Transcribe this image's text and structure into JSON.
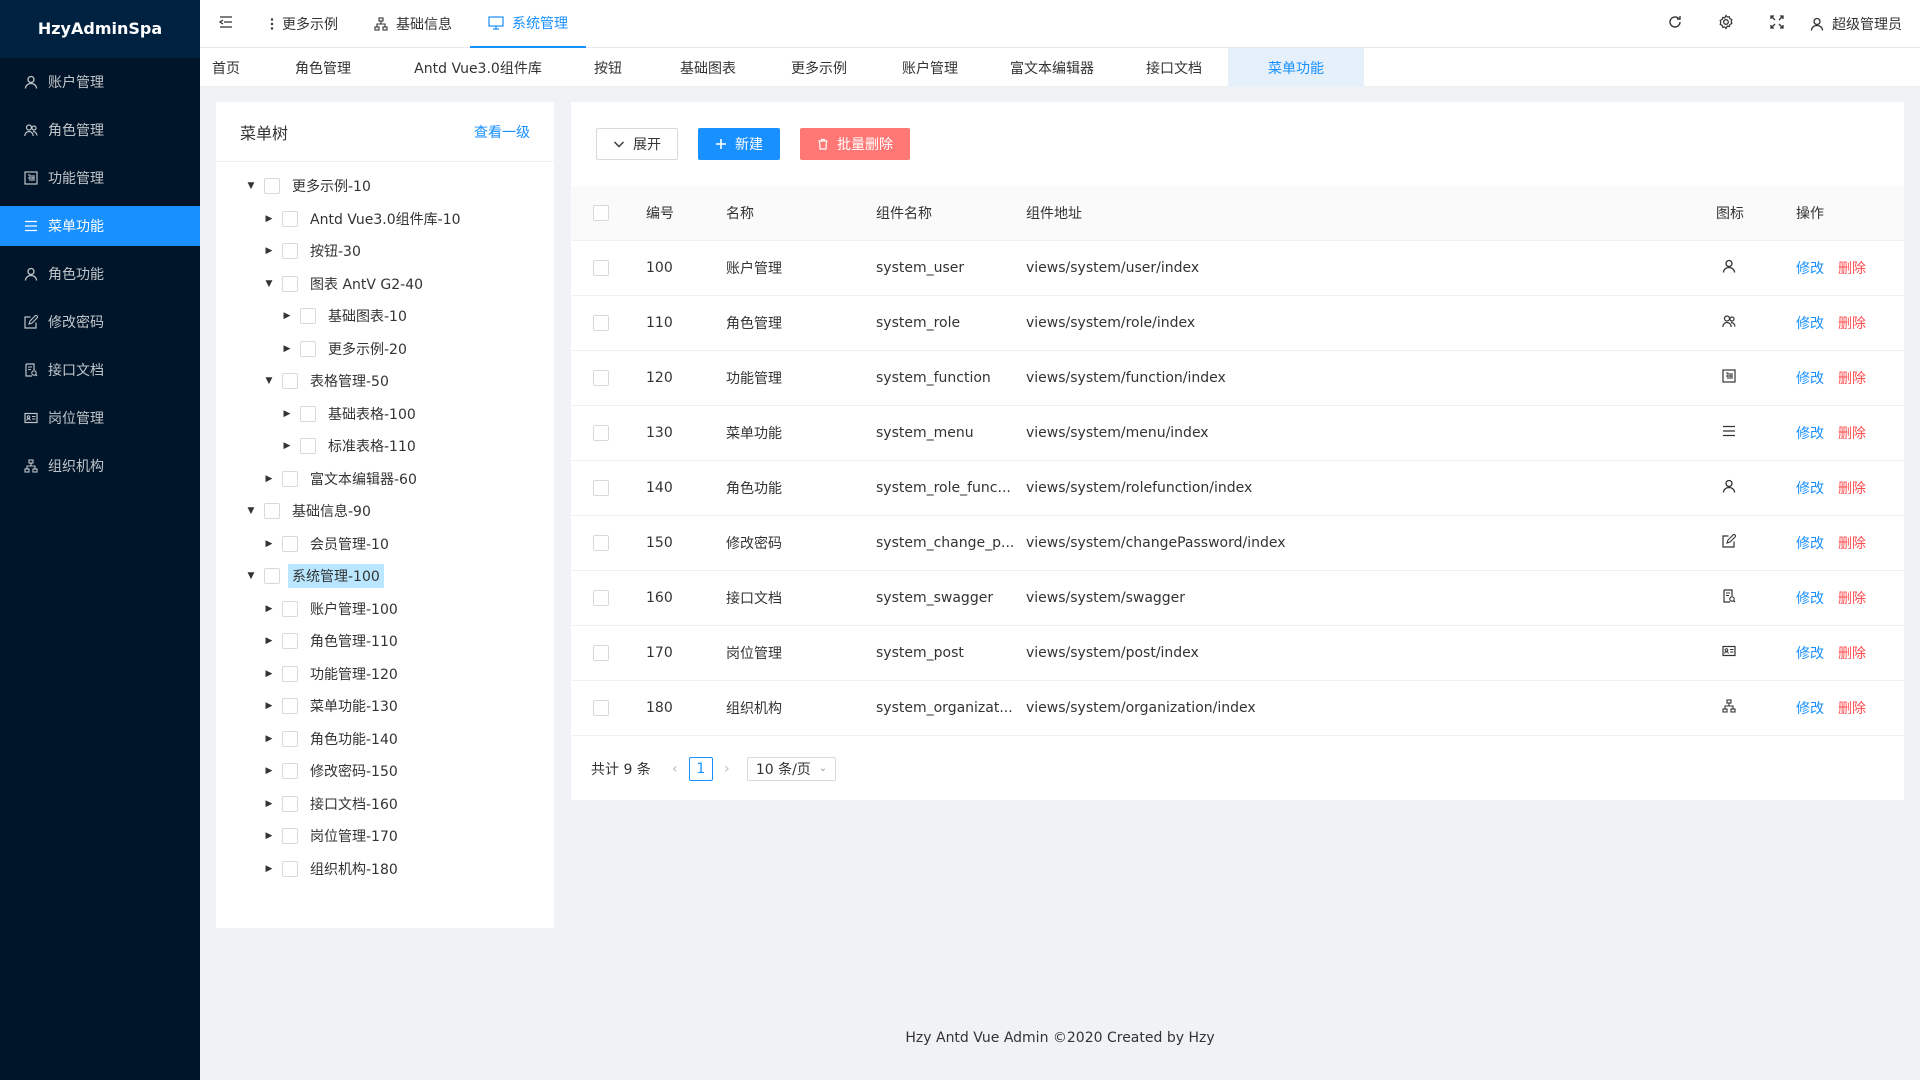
{
  "app": {
    "title": "HzyAdminSpa"
  },
  "sidebar": {
    "items": [
      {
        "label": "账户管理",
        "icon": "user-icon",
        "active": false
      },
      {
        "label": "角色管理",
        "icon": "team-icon",
        "active": false
      },
      {
        "label": "功能管理",
        "icon": "function-icon",
        "active": false
      },
      {
        "label": "菜单功能",
        "icon": "menu-icon",
        "active": true
      },
      {
        "label": "角色功能",
        "icon": "user-icon",
        "active": false
      },
      {
        "label": "修改密码",
        "icon": "edit-icon",
        "active": false
      },
      {
        "label": "接口文档",
        "icon": "doc-icon",
        "active": false
      },
      {
        "label": "岗位管理",
        "icon": "idcard-icon",
        "active": false
      },
      {
        "label": "组织机构",
        "icon": "cluster-icon",
        "active": false
      }
    ]
  },
  "header": {
    "menu": [
      {
        "label": "更多示例",
        "icon": "more-vertical-icon",
        "active": false
      },
      {
        "label": "基础信息",
        "icon": "cluster-icon",
        "active": false
      },
      {
        "label": "系统管理",
        "icon": "desktop-icon",
        "active": true
      }
    ],
    "user": "超级管理员"
  },
  "tabs": [
    {
      "label": "首页",
      "active": false
    },
    {
      "label": "角色管理",
      "active": false
    },
    {
      "label": "Antd Vue3.0组件库",
      "active": false
    },
    {
      "label": "按钮",
      "active": false
    },
    {
      "label": "基础图表",
      "active": false
    },
    {
      "label": "更多示例",
      "active": false
    },
    {
      "label": "账户管理",
      "active": false
    },
    {
      "label": "富文本编辑器",
      "active": false
    },
    {
      "label": "接口文档",
      "active": false
    },
    {
      "label": "菜单功能",
      "active": true
    }
  ],
  "tree": {
    "title": "菜单树",
    "link": "查看一级",
    "nodes": [
      {
        "label": "更多示例-10",
        "level": 0,
        "expanded": true,
        "selected": false
      },
      {
        "label": "Antd Vue3.0组件库-10",
        "level": 1,
        "expanded": false,
        "selected": false
      },
      {
        "label": "按钮-30",
        "level": 1,
        "expanded": false,
        "selected": false
      },
      {
        "label": "图表 AntV G2-40",
        "level": 1,
        "expanded": true,
        "selected": false
      },
      {
        "label": "基础图表-10",
        "level": 2,
        "expanded": false,
        "selected": false
      },
      {
        "label": "更多示例-20",
        "level": 2,
        "expanded": false,
        "selected": false
      },
      {
        "label": "表格管理-50",
        "level": 1,
        "expanded": true,
        "selected": false
      },
      {
        "label": "基础表格-100",
        "level": 2,
        "expanded": false,
        "selected": false
      },
      {
        "label": "标准表格-110",
        "level": 2,
        "expanded": false,
        "selected": false
      },
      {
        "label": "富文本编辑器-60",
        "level": 1,
        "expanded": false,
        "selected": false
      },
      {
        "label": "基础信息-90",
        "level": 0,
        "expanded": true,
        "selected": false
      },
      {
        "label": "会员管理-10",
        "level": 1,
        "expanded": false,
        "selected": false
      },
      {
        "label": "系统管理-100",
        "level": 0,
        "expanded": true,
        "selected": true
      },
      {
        "label": "账户管理-100",
        "level": 1,
        "expanded": false,
        "selected": false
      },
      {
        "label": "角色管理-110",
        "level": 1,
        "expanded": false,
        "selected": false
      },
      {
        "label": "功能管理-120",
        "level": 1,
        "expanded": false,
        "selected": false
      },
      {
        "label": "菜单功能-130",
        "level": 1,
        "expanded": false,
        "selected": false
      },
      {
        "label": "角色功能-140",
        "level": 1,
        "expanded": false,
        "selected": false
      },
      {
        "label": "修改密码-150",
        "level": 1,
        "expanded": false,
        "selected": false
      },
      {
        "label": "接口文档-160",
        "level": 1,
        "expanded": false,
        "selected": false
      },
      {
        "label": "岗位管理-170",
        "level": 1,
        "expanded": false,
        "selected": false
      },
      {
        "label": "组织机构-180",
        "level": 1,
        "expanded": false,
        "selected": false
      }
    ]
  },
  "toolbar": {
    "expand_label": "展开",
    "new_label": "新建",
    "batch_delete_label": "批量删除"
  },
  "table": {
    "columns": [
      "编号",
      "名称",
      "组件名称",
      "组件地址",
      "图标",
      "操作"
    ],
    "edit_label": "修改",
    "delete_label": "删除",
    "rows": [
      {
        "no": "100",
        "name": "账户管理",
        "component": "system_user",
        "url": "views/system/user/index",
        "icon": "user-icon"
      },
      {
        "no": "110",
        "name": "角色管理",
        "component": "system_role",
        "url": "views/system/role/index",
        "icon": "team-icon"
      },
      {
        "no": "120",
        "name": "功能管理",
        "component": "system_function",
        "url": "views/system/function/index",
        "icon": "function-icon"
      },
      {
        "no": "130",
        "name": "菜单功能",
        "component": "system_menu",
        "url": "views/system/menu/index",
        "icon": "menu-icon"
      },
      {
        "no": "140",
        "name": "角色功能",
        "component": "system_role_func...",
        "url": "views/system/rolefunction/index",
        "icon": "user-icon"
      },
      {
        "no": "150",
        "name": "修改密码",
        "component": "system_change_p...",
        "url": "views/system/changePassword/index",
        "icon": "edit-icon"
      },
      {
        "no": "160",
        "name": "接口文档",
        "component": "system_swagger",
        "url": "views/system/swagger",
        "icon": "doc-icon"
      },
      {
        "no": "170",
        "name": "岗位管理",
        "component": "system_post",
        "url": "views/system/post/index",
        "icon": "idcard-icon"
      },
      {
        "no": "180",
        "name": "组织机构",
        "component": "system_organizat...",
        "url": "views/system/organization/index",
        "icon": "cluster-icon"
      }
    ]
  },
  "pagination": {
    "total": "共计 9 条",
    "current": "1",
    "page_size": "10 条/页"
  },
  "footer": {
    "text": "Hzy Antd Vue Admin ©2020 Created by Hzy"
  },
  "colors": {
    "sidebar_bg": "#001529",
    "primary": "#1890ff",
    "danger": "#ff4d4f"
  }
}
